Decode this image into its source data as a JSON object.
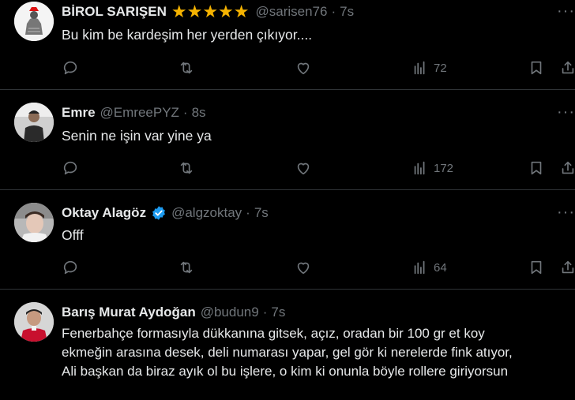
{
  "tweets": [
    {
      "name": "BİROL SARIŞEN",
      "stars": "★★★★★",
      "handle": "@sarisen76",
      "sep": "·",
      "time": "7s",
      "text": "Bu kim be kardeşim her yerden çıkıyor....",
      "views": "72",
      "verified": false
    },
    {
      "name": "Emre",
      "handle": "@EmreePYZ",
      "sep": "·",
      "time": "8s",
      "text": "Senin ne işin var yine ya",
      "views": "172",
      "verified": false
    },
    {
      "name": "Oktay Alagöz",
      "handle": "@algzoktay",
      "sep": "·",
      "time": "7s",
      "text": "Offf",
      "views": "64",
      "verified": true
    },
    {
      "name": "Barış Murat Aydoğan",
      "handle": "@budun9",
      "sep": "·",
      "time": "7s",
      "text_lines": [
        "Fenerbahçe formasıyla dükkanına gitsek, açız, oradan bir 100 gr et koy",
        "ekmeğin arasına desek, deli numarası yapar, gel gör ki nerelerde fink atıyor,",
        "Ali başkan da biraz ayık ol bu işlere, o kim ki onunla böyle rollere giriyorsun"
      ],
      "verified": false
    }
  ],
  "more_label": "···",
  "icons": [
    "reply-icon",
    "retweet-icon",
    "like-icon",
    "views-icon",
    "bookmark-icon",
    "share-icon",
    "verified-badge-icon",
    "more-icon"
  ],
  "colors": {
    "background": "#000000",
    "text": "#e7e9ea",
    "muted": "#71767b",
    "divider": "#2f3336",
    "verified": "#1d9bf0",
    "star": "#f5b301"
  }
}
